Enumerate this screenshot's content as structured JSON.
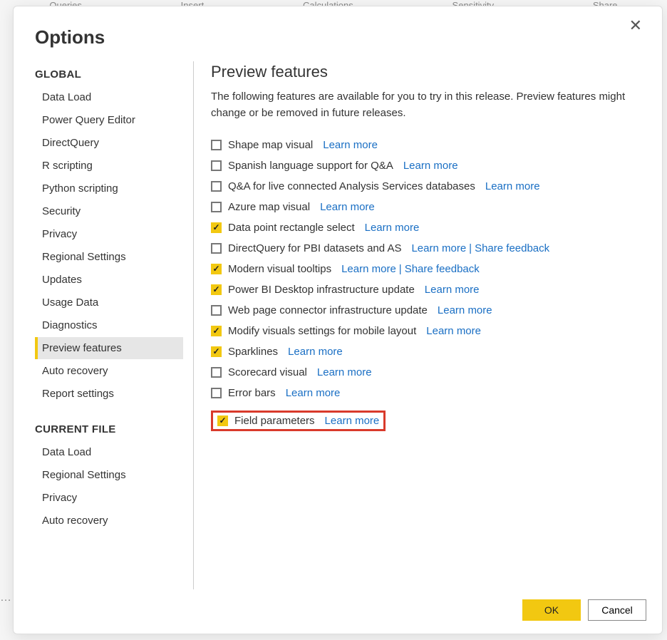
{
  "ribbon": [
    "Queries",
    "Insert",
    "Calculations",
    "Sensitivity",
    "Share"
  ],
  "dialog": {
    "title": "Options",
    "sidebar": {
      "global_header": "GLOBAL",
      "global_items": [
        "Data Load",
        "Power Query Editor",
        "DirectQuery",
        "R scripting",
        "Python scripting",
        "Security",
        "Privacy",
        "Regional Settings",
        "Updates",
        "Usage Data",
        "Diagnostics",
        "Preview features",
        "Auto recovery",
        "Report settings"
      ],
      "current_header": "CURRENT FILE",
      "current_items": [
        "Data Load",
        "Regional Settings",
        "Privacy",
        "Auto recovery"
      ],
      "selected": "Preview features"
    },
    "content": {
      "title": "Preview features",
      "description": "The following features are available for you to try in this release. Preview features might change or be removed in future releases.",
      "features": [
        {
          "label": "Shape map visual",
          "checked": false,
          "links": [
            "Learn more"
          ]
        },
        {
          "label": "Spanish language support for Q&A",
          "checked": false,
          "links": [
            "Learn more"
          ]
        },
        {
          "label": "Q&A for live connected Analysis Services databases",
          "checked": false,
          "links": [
            "Learn more"
          ]
        },
        {
          "label": "Azure map visual",
          "checked": false,
          "links": [
            "Learn more"
          ]
        },
        {
          "label": "Data point rectangle select",
          "checked": true,
          "links": [
            "Learn more"
          ]
        },
        {
          "label": "DirectQuery for PBI datasets and AS",
          "checked": false,
          "links": [
            "Learn more",
            "Share feedback"
          ]
        },
        {
          "label": "Modern visual tooltips",
          "checked": true,
          "links": [
            "Learn more",
            "Share feedback"
          ]
        },
        {
          "label": "Power BI Desktop infrastructure update",
          "checked": true,
          "links": [
            "Learn more"
          ]
        },
        {
          "label": "Web page connector infrastructure update",
          "checked": false,
          "links": [
            "Learn more"
          ]
        },
        {
          "label": "Modify visuals settings for mobile layout",
          "checked": true,
          "links": [
            "Learn more"
          ]
        },
        {
          "label": "Sparklines",
          "checked": true,
          "links": [
            "Learn more"
          ]
        },
        {
          "label": "Scorecard visual",
          "checked": false,
          "links": [
            "Learn more"
          ]
        },
        {
          "label": "Error bars",
          "checked": false,
          "links": [
            "Learn more"
          ]
        },
        {
          "label": "Field parameters",
          "checked": true,
          "links": [
            "Learn more"
          ],
          "highlighted": true
        }
      ]
    },
    "buttons": {
      "ok": "OK",
      "cancel": "Cancel"
    }
  }
}
